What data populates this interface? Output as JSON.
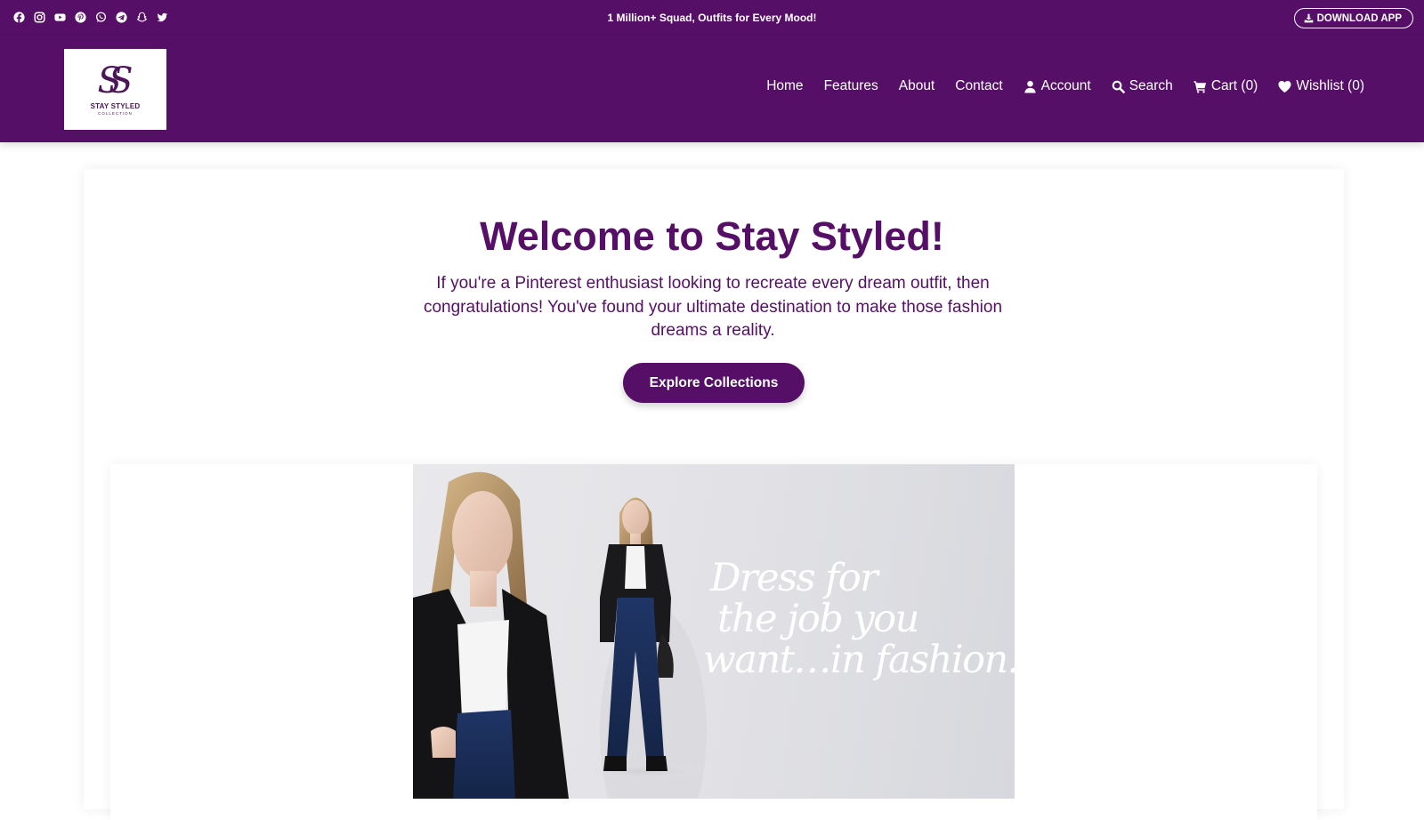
{
  "topbar": {
    "promo": "1 Million+ Squad, Outfits for Every Mood!",
    "download_label": "DOWNLOAD APP",
    "social_icons": [
      "facebook-icon",
      "instagram-icon",
      "youtube-icon",
      "pinterest-icon",
      "whatsapp-icon",
      "telegram-icon",
      "snapchat-icon",
      "twitter-icon"
    ]
  },
  "brand": {
    "name": "STAY STYLED",
    "sub": "COLLECTION",
    "mark": "SS"
  },
  "nav": {
    "home": "Home",
    "features": "Features",
    "about": "About",
    "contact": "Contact",
    "account": "Account",
    "search": "Search",
    "cart": "Cart (0)",
    "wishlist": "Wishlist (0)"
  },
  "hero": {
    "title": "Welcome to Stay Styled!",
    "text": "If you're a Pinterest enthusiast looking to recreate every dream outfit, then congratulations! You've found your ultimate destination to make those fashion dreams a reality.",
    "button": "Explore Collections"
  },
  "banner": {
    "line1": "Dress for",
    "line2": "the job you",
    "line3": "want…in fashion."
  },
  "colors": {
    "brand": "#560f66",
    "white": "#ffffff"
  }
}
